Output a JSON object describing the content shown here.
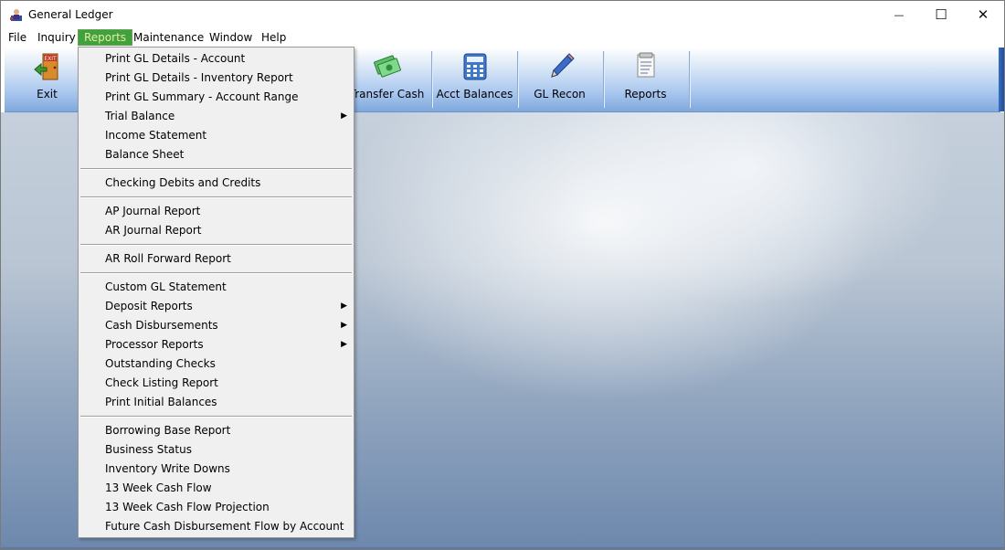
{
  "window": {
    "title": "General Ledger",
    "minimize_glyph": "—",
    "maximize_glyph": "☐",
    "close_glyph": "✕",
    "icon": "app-figure-icon"
  },
  "menubar": {
    "items": [
      {
        "label": "File"
      },
      {
        "label": "Inquiry"
      },
      {
        "label": "Reports",
        "active": true
      },
      {
        "label": "Maintenance"
      },
      {
        "label": "Window"
      },
      {
        "label": "Help"
      }
    ]
  },
  "toolbar": {
    "buttons": [
      {
        "label": "Exit",
        "icon": "exit-door-icon"
      },
      {
        "label": "Transfer Cash",
        "icon": "cash-icon"
      },
      {
        "label": "Acct Balances",
        "icon": "calculator-icon"
      },
      {
        "label": "GL Recon",
        "icon": "pencil-icon"
      },
      {
        "label": "Reports",
        "icon": "report-document-icon"
      }
    ]
  },
  "reports_menu": {
    "groups": [
      [
        {
          "label": "Print GL Details - Account"
        },
        {
          "label": "Print GL Details - Inventory Report"
        },
        {
          "label": "Print GL Summary - Account Range"
        },
        {
          "label": "Trial Balance",
          "submenu": true
        },
        {
          "label": "Income Statement"
        },
        {
          "label": "Balance Sheet"
        }
      ],
      [
        {
          "label": "Checking Debits and Credits"
        }
      ],
      [
        {
          "label": "AP Journal Report"
        },
        {
          "label": "AR Journal Report"
        }
      ],
      [
        {
          "label": "AR Roll Forward Report"
        }
      ],
      [
        {
          "label": "Custom GL Statement"
        },
        {
          "label": "Deposit Reports",
          "submenu": true
        },
        {
          "label": "Cash Disbursements",
          "submenu": true
        },
        {
          "label": "Processor Reports",
          "submenu": true
        },
        {
          "label": "Outstanding Checks"
        },
        {
          "label": "Check Listing Report"
        },
        {
          "label": "Print Initial Balances"
        }
      ],
      [
        {
          "label": "Borrowing Base Report"
        },
        {
          "label": "Business Status"
        },
        {
          "label": "Inventory Write Downs"
        },
        {
          "label": "13 Week Cash Flow"
        },
        {
          "label": "13 Week Cash Flow Projection"
        },
        {
          "label": "Future Cash Disbursement Flow by Account"
        }
      ]
    ],
    "submenu_arrow": "▶"
  },
  "colors": {
    "menu_active_bg": "#3fa23a",
    "menu_active_fg": "#e9e9a8",
    "toolbar_blue": "#7fa8dd"
  }
}
